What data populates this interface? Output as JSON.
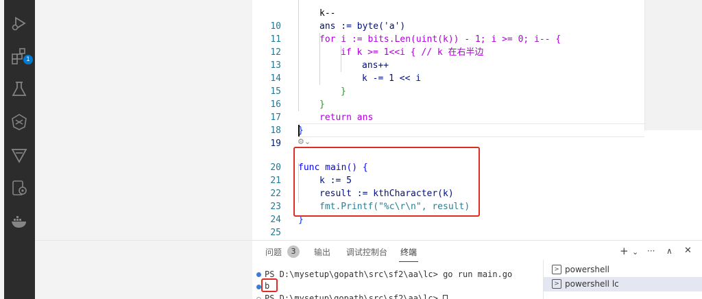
{
  "activity_bar": {
    "icons": [
      "run-debug-icon",
      "extensions-icon",
      "testing-icon",
      "remote-icon",
      "gitlens-icon",
      "copilot-icon",
      "docker-icon"
    ],
    "extensions_badge": "1",
    "accent": "#007acc"
  },
  "editor": {
    "lines": [
      {
        "n": "",
        "text": "k--"
      },
      {
        "n": "10",
        "text": "ans := byte('a')"
      },
      {
        "n": "11",
        "text": "for i := bits.Len(uint(k)) - 1; i >= 0; i-- {"
      },
      {
        "n": "12",
        "text": "if k >= 1<<i { // k 在右半边"
      },
      {
        "n": "13",
        "text": "ans++"
      },
      {
        "n": "14",
        "text": "k -= 1 << i"
      },
      {
        "n": "15",
        "text": "}"
      },
      {
        "n": "16",
        "text": "}"
      },
      {
        "n": "17",
        "text": "return ans"
      },
      {
        "n": "18",
        "text": "}"
      },
      {
        "n": "19",
        "text": ""
      },
      {
        "n": "20",
        "text": "func main() {"
      },
      {
        "n": "21",
        "text": "k := 5"
      },
      {
        "n": "22",
        "text": "result := kthCharacter(k)"
      },
      {
        "n": "23",
        "text": "fmt.Printf(\"%c\\r\\n\", result)"
      },
      {
        "n": "24",
        "text": "}"
      },
      {
        "n": "25",
        "text": ""
      }
    ],
    "highlight_color": "#e02b20"
  },
  "panel": {
    "tabs": [
      {
        "label": "问题",
        "badge": "3"
      },
      {
        "label": "输出"
      },
      {
        "label": "调试控制台"
      },
      {
        "label": "终端",
        "active": true
      }
    ],
    "actions": [
      "+",
      "⌄",
      "···",
      "∧",
      "✕"
    ],
    "terminal": {
      "line1": "PS D:\\mysetup\\gopath\\src\\sf2\\aa\\lc> go run main.go",
      "line2": "b",
      "line3": "PS D:\\mysetup\\gopath\\src\\sf2\\aa\\lc> "
    },
    "terminal_list": [
      {
        "label": "powershell"
      },
      {
        "label": "powershell  lc",
        "selected": true
      }
    ]
  }
}
